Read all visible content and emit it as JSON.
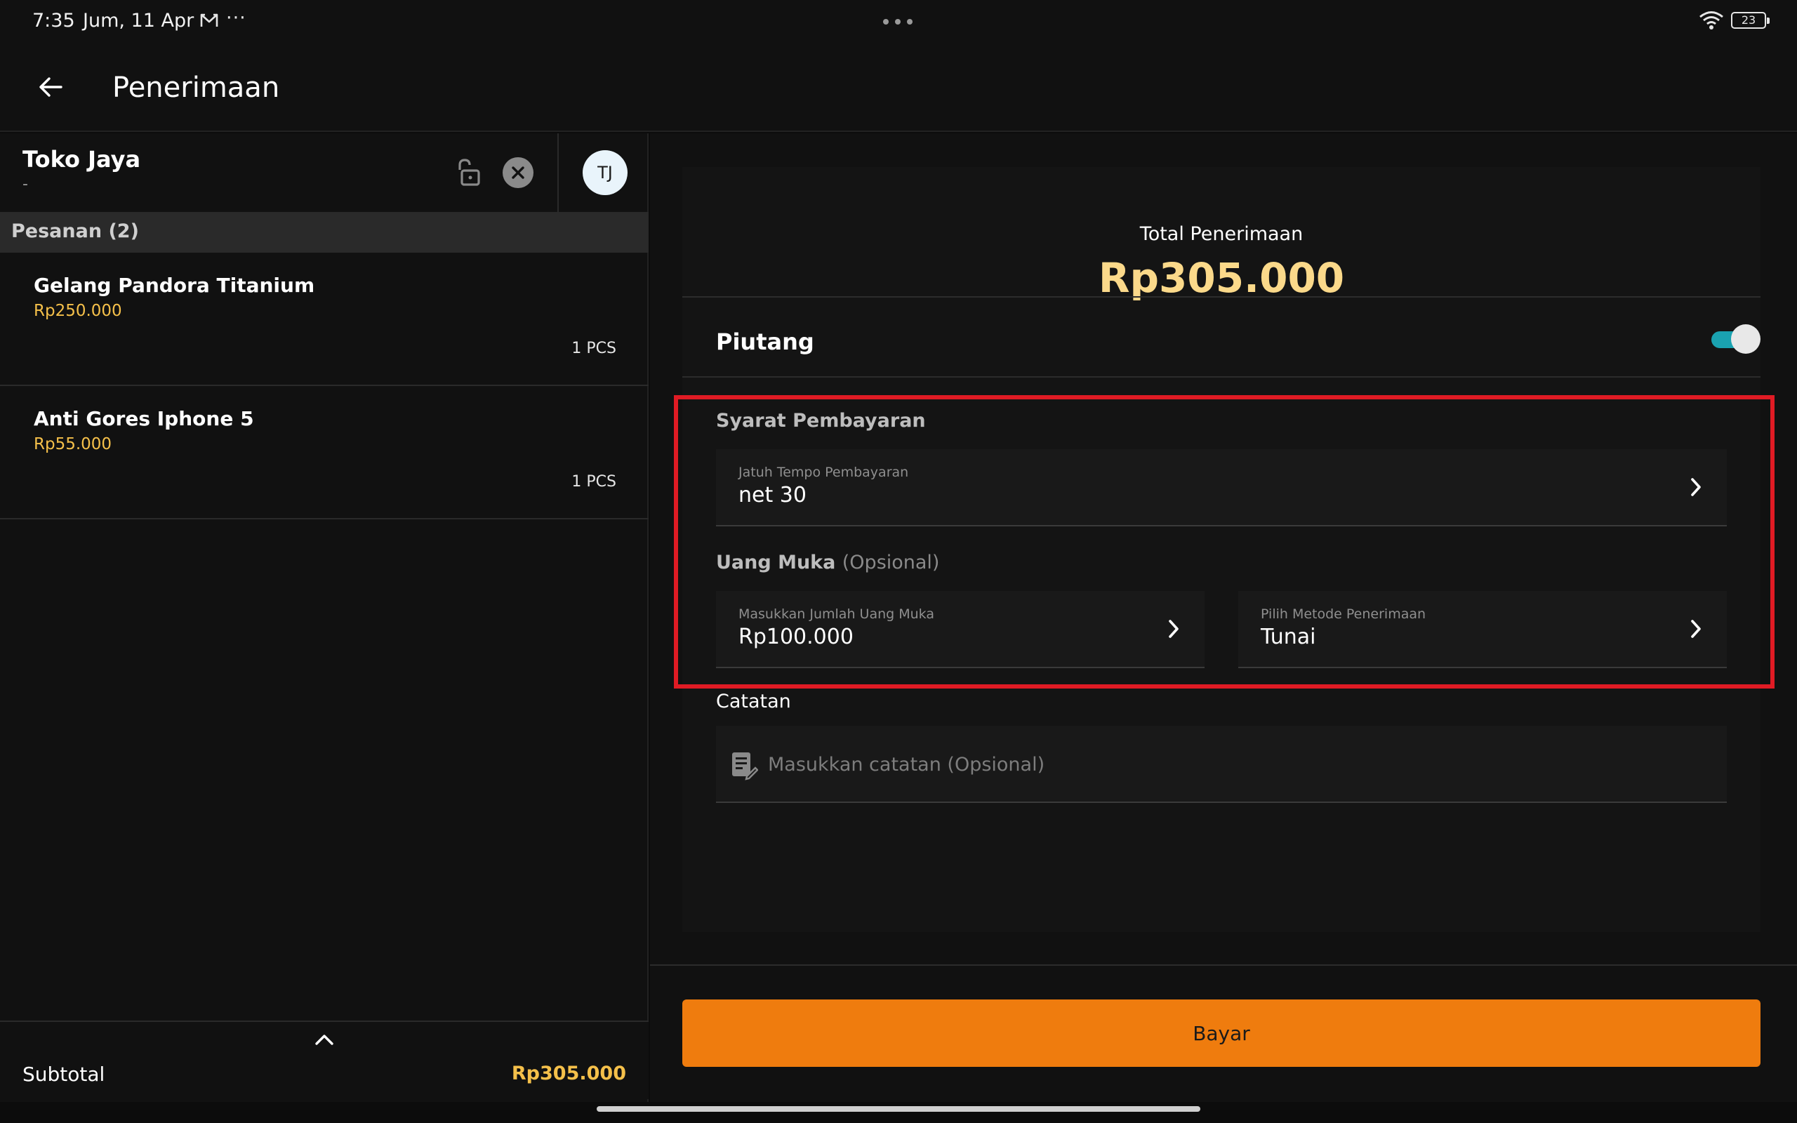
{
  "status_bar": {
    "time": "7:35",
    "date": "Jum, 11 Apr",
    "more": "···",
    "battery": "23"
  },
  "header": {
    "title": "Penerimaan"
  },
  "customer": {
    "name": "Toko Jaya",
    "subtitle": "-",
    "avatar_initials": "TJ"
  },
  "orders": {
    "header": "Pesanan (2)",
    "items": [
      {
        "name": "Gelang Pandora Titanium",
        "price": "Rp250.000",
        "qty": "1 PCS"
      },
      {
        "name": "Anti Gores Iphone 5",
        "price": "Rp55.000",
        "qty": "1 PCS"
      }
    ],
    "subtotal_label": "Subtotal",
    "subtotal_value": "Rp305.000"
  },
  "payment": {
    "total_label": "Total Penerimaan",
    "total_value": "Rp305.000",
    "piutang_label": "Piutang",
    "piutang_enabled": true,
    "terms_title": "Syarat Pembayaran",
    "due_label": "Jatuh Tempo Pembayaran",
    "due_value": "net 30",
    "dp_title": "Uang Muka",
    "dp_optional": "(Opsional)",
    "dp_amount_label": "Masukkan Jumlah Uang Muka",
    "dp_amount_value": "Rp100.000",
    "method_label": "Pilih Metode Penerimaan",
    "method_value": "Tunai",
    "note_label": "Catatan",
    "note_placeholder": "Masukkan catatan (Opsional)",
    "pay_button": "Bayar"
  },
  "colors": {
    "accent_orange": "#ef7c0e",
    "price_yellow": "#f5c04a",
    "total_yellow": "#fbd98a",
    "toggle_teal": "#1aa2b0",
    "highlight_red": "#e01b24"
  }
}
